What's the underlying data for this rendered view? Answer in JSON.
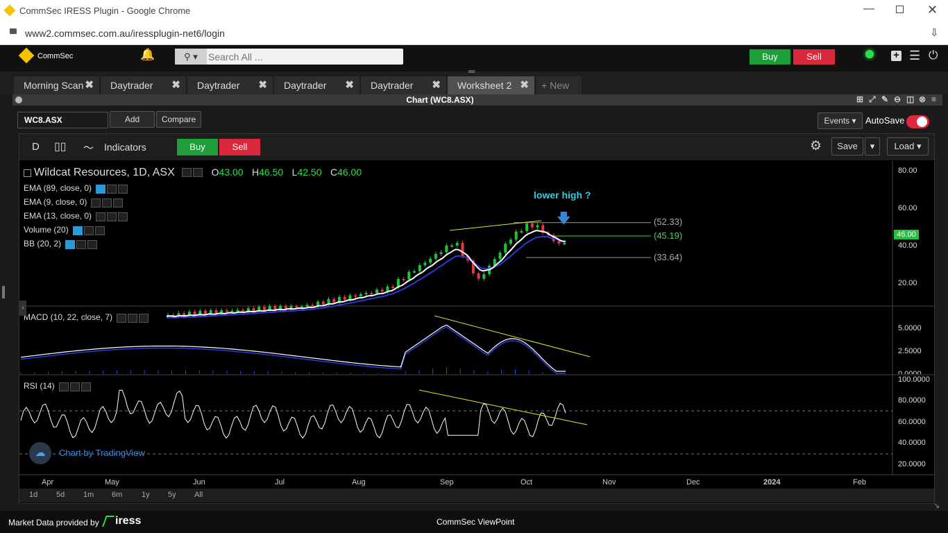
{
  "window": {
    "title": "CommSec IRESS Plugin - Google Chrome",
    "url": "www2.commsec.com.au/iressplugin-net6/login"
  },
  "app": {
    "brand": "CommSec",
    "search_placeholder": "Search All ...",
    "buy": "Buy",
    "sell": "Sell"
  },
  "tabs": [
    {
      "label": "Morning Scan"
    },
    {
      "label": "Daytrader"
    },
    {
      "label": "Daytrader"
    },
    {
      "label": "Daytrader"
    },
    {
      "label": "Daytrader"
    },
    {
      "label": "Worksheet 2"
    }
  ],
  "new_tab": "New",
  "panel": {
    "title": "Chart (WC8.ASX)"
  },
  "symbol": {
    "value": "WC8.ASX",
    "add": "Add",
    "compare": "Compare",
    "events": "Events",
    "autosave": "AutoSave"
  },
  "toolbar": {
    "interval": "D",
    "indicators": "Indicators",
    "buy": "Buy",
    "sell": "Sell",
    "save": "Save",
    "load": "Load"
  },
  "legend": {
    "name": "Wildcat Resources, 1D, ASX",
    "o_label": "O",
    "o": "43.00",
    "h_label": "H",
    "h": "46.50",
    "l_label": "L",
    "l": "42.50",
    "c_label": "C",
    "c": "46.00"
  },
  "indicators": [
    "EMA (89, close, 0)",
    "EMA (9, close, 0)",
    "EMA (13, close, 0)",
    "Volume (20)",
    "BB (20, 2)"
  ],
  "annotation": "lower high ?",
  "levels": [
    {
      "label": "(52.33)",
      "value": 52.33
    },
    {
      "label": "(45.19)",
      "value": 45.19
    },
    {
      "label": "(33.64)",
      "value": 33.64
    }
  ],
  "price_axis": [
    "80.00",
    "60.00",
    "40.00",
    "20.00"
  ],
  "last_price": "46.00",
  "macd": {
    "label": "MACD (10, 22, close, 7)",
    "axis": [
      "5.0000",
      "2.5000",
      "0.0000"
    ]
  },
  "rsi": {
    "label": "RSI (14)",
    "axis": [
      "100.0000",
      "80.0000",
      "60.0000",
      "40.0000",
      "20.0000"
    ]
  },
  "x_axis": [
    "Apr",
    "May",
    "Jun",
    "Jul",
    "Aug",
    "Sep",
    "Oct",
    "Nov",
    "Dec",
    "2024",
    "Feb"
  ],
  "watermark": "Chart by TradingView",
  "ranges": [
    "1d",
    "5d",
    "1m",
    "6m",
    "1y",
    "5y",
    "All"
  ],
  "footer": {
    "provider": "Market Data provided by",
    "brand": "iress",
    "center": "CommSec ViewPoint"
  },
  "colors": {
    "up": "#22c33a",
    "down": "#e23b3b",
    "buy": "#1e9e3a",
    "sell": "#d9283b",
    "accent": "#2a9bd6",
    "annotation": "#2ad0e6",
    "trendline": "#e6e62a"
  }
}
